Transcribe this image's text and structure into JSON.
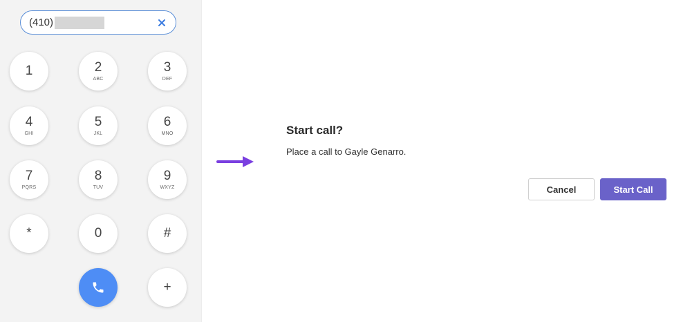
{
  "dialpad": {
    "number_prefix": "(410)",
    "keys": [
      {
        "digit": "1",
        "letters": ""
      },
      {
        "digit": "2",
        "letters": "ABC"
      },
      {
        "digit": "3",
        "letters": "DEF"
      },
      {
        "digit": "4",
        "letters": "GHI"
      },
      {
        "digit": "5",
        "letters": "JKL"
      },
      {
        "digit": "6",
        "letters": "MNO"
      },
      {
        "digit": "7",
        "letters": "PQRS"
      },
      {
        "digit": "8",
        "letters": "TUV"
      },
      {
        "digit": "9",
        "letters": "WXYZ"
      },
      {
        "digit": "*",
        "letters": ""
      },
      {
        "digit": "0",
        "letters": ""
      },
      {
        "digit": "#",
        "letters": ""
      }
    ],
    "plus_label": "+",
    "call_icon": "phone-icon",
    "clear_icon": "close-icon"
  },
  "dialog": {
    "title": "Start call?",
    "message": "Place a call to Gayle Genarro.",
    "cancel_label": "Cancel",
    "start_label": "Start Call"
  },
  "colors": {
    "accent": "#6a62c9",
    "call_button": "#4e8df5",
    "arrow": "#7a3fe0",
    "field_border": "#5b8fd8"
  }
}
